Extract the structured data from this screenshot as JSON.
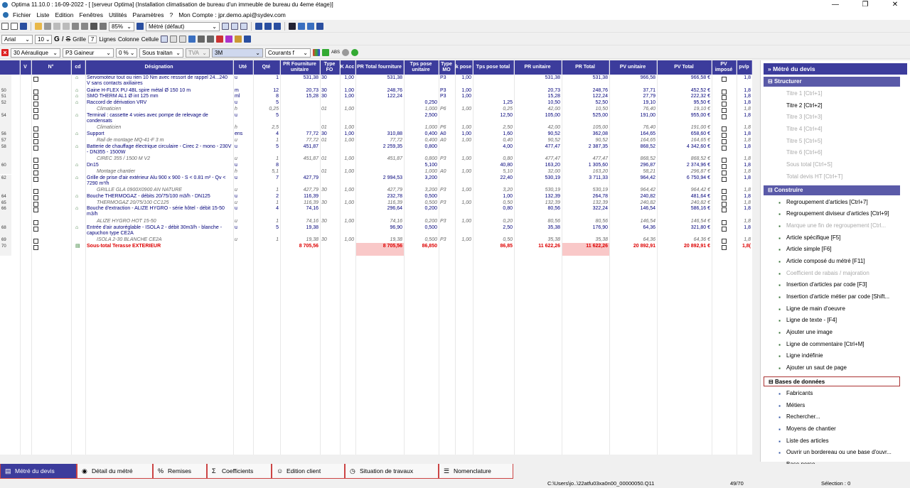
{
  "window": {
    "title": "Optima 11.10.0 : 16-09-2022 - [ [serveur Optima] (Installation climatisation de bureau d'un immeuble de bureau du 4eme étage)]",
    "buttons": [
      "—",
      "❐",
      "✕"
    ]
  },
  "menu": [
    "Fichier",
    "Liste",
    "Edition",
    "Fenêtres",
    "Utilités",
    "Paramètres",
    "?",
    "Mon Compte : jpr.demo.api@sydev.com"
  ],
  "toolbar1": {
    "zoom": "85%",
    "view": "Métré (défaut)"
  },
  "toolbar2": {
    "font": "Arial",
    "size": "10",
    "bold": "G",
    "italic": "I",
    "strike": "S",
    "grid_label": "Grille",
    "grid_value": "7",
    "lines_label": "Lignes",
    "column_label": "Colonne",
    "cell_label": "Cellule"
  },
  "toolbar3": {
    "lot": "30  Aéraulique",
    "family": "P3  Gaineur",
    "rate": "0 %",
    "subcontract": "Sous traitan",
    "tva": "TVA",
    "series": "3M",
    "currency": "Courants f",
    "abs": "ABS"
  },
  "columns": [
    "",
    "V",
    "N°",
    "cd",
    "Désignation",
    "Uté",
    "Qté",
    "PR Fourniture unitaire",
    "Type FO",
    "K Acc",
    "PR Total fourniture",
    "Tps pose unitaire",
    "Type MO",
    "k pose",
    "Tps pose total",
    "PR unitaire",
    "PR Total",
    "PV unitaire",
    "PV Total",
    "PV imposé",
    "pv/p"
  ],
  "rows": [
    {
      "ln": "",
      "des": "Servomoteur tout ou rien 10 Nm avec ressort de rappel 24...240 V sans contacts axiliaires",
      "u": "u",
      "q": "1",
      "pru": "531,38",
      "tfo": "30",
      "k": "1,00",
      "prt": "531,38",
      "tpu": "",
      "tmo": "P3",
      "kp": "1,00",
      "tpt": "",
      "pr": "531,38",
      "prtot": "531,38",
      "pvu": "966,58",
      "pvt": "966,58 €",
      "pp": "1,8",
      "h": 2
    },
    {
      "ln": "50",
      "des": "Gaine H-FLEX PU 4BL spire métal Ø 150 10 m",
      "u": "m",
      "q": "12",
      "pru": "20,73",
      "tfo": "30",
      "k": "1,00",
      "prt": "248,76",
      "tpu": "",
      "tmo": "P3",
      "kp": "1,00",
      "tpt": "",
      "pr": "20,73",
      "prtot": "248,76",
      "pvu": "37,71",
      "pvt": "452,52 €",
      "pp": "1,8",
      "h": 1
    },
    {
      "ln": "51",
      "des": "SMO THERM AL1 Ø int 125 mm",
      "u": "ml",
      "q": "8",
      "pru": "15,28",
      "tfo": "30",
      "k": "1,00",
      "prt": "122,24",
      "tpu": "",
      "tmo": "P3",
      "kp": "1,00",
      "tpt": "",
      "pr": "15,28",
      "prtot": "122,24",
      "pvu": "27,79",
      "pvt": "222,32 €",
      "pp": "1,8",
      "h": 1
    },
    {
      "ln": "52",
      "des": "Raccord de dérivation VRV",
      "u": "u",
      "q": "5",
      "pru": "",
      "tfo": "",
      "k": "",
      "prt": "",
      "tpu": "0,250",
      "tmo": "",
      "kp": "",
      "tpt": "1,25",
      "pr": "10,50",
      "prtot": "52,50",
      "pvu": "19,10",
      "pvt": "95,50 €",
      "pp": "1,8",
      "h": 1
    },
    {
      "ln": "",
      "des": "Climaticien",
      "u": "h",
      "q": "0,25",
      "pru": "",
      "tfo": "01",
      "k": "1,00",
      "prt": "",
      "tpu": "1,000",
      "tmo": "P6",
      "kp": "1,00",
      "tpt": "0,25",
      "pr": "42,00",
      "prtot": "10,50",
      "pvu": "76,40",
      "pvt": "19,10 €",
      "pp": "1,8",
      "h": 1,
      "sub": true
    },
    {
      "ln": "54",
      "des": "Terminal : cassette 4 voies avec pompe de relevage de condensats",
      "u": "u",
      "q": "5",
      "pru": "",
      "tfo": "",
      "k": "",
      "prt": "",
      "tpu": "2,500",
      "tmo": "",
      "kp": "",
      "tpt": "12,50",
      "pr": "105,00",
      "prtot": "525,00",
      "pvu": "191,00",
      "pvt": "955,00 €",
      "pp": "1,8",
      "h": 2
    },
    {
      "ln": "",
      "des": "Climaticien",
      "u": "h",
      "q": "2,5",
      "pru": "",
      "tfo": "01",
      "k": "1,00",
      "prt": "",
      "tpu": "1,000",
      "tmo": "P6",
      "kp": "1,00",
      "tpt": "2,50",
      "pr": "42,00",
      "prtot": "105,00",
      "pvu": "76,40",
      "pvt": "191,00 €",
      "pp": "1,8",
      "h": 1,
      "sub": true
    },
    {
      "ln": "56",
      "des": "Support",
      "u": "ens",
      "q": "4",
      "pru": "77,72",
      "tfo": "30",
      "k": "1,00",
      "prt": "310,88",
      "tpu": "0,400",
      "tmo": "A0",
      "kp": "1,00",
      "tpt": "1,60",
      "pr": "90,52",
      "prtot": "362,08",
      "pvu": "164,65",
      "pvt": "658,60 €",
      "pp": "1,8",
      "h": 1
    },
    {
      "ln": "57",
      "des": "Rail de montage MQ-41-F 3 m",
      "u": "u",
      "q": "1",
      "pru": "77,72",
      "tfo": "01",
      "k": "1,00",
      "prt": "77,72",
      "tpu": "0,400",
      "tmo": "A0",
      "kp": "1,00",
      "tpt": "0,40",
      "pr": "90,52",
      "prtot": "90,52",
      "pvu": "164,65",
      "pvt": "164,65 €",
      "pp": "1,8",
      "h": 1,
      "sub": true
    },
    {
      "ln": "58",
      "des": "Batterie de chauffage électrique circulaire - Cirec 2 - mono - 230V - DN355 - 1500W",
      "u": "u",
      "q": "5",
      "pru": "451,87",
      "tfo": "",
      "k": "",
      "prt": "2 259,35",
      "tpu": "0,800",
      "tmo": "",
      "kp": "",
      "tpt": "4,00",
      "pr": "477,47",
      "prtot": "2 387,35",
      "pvu": "868,52",
      "pvt": "4 342,60 €",
      "pp": "1,8",
      "h": 2
    },
    {
      "ln": "",
      "des": "CIREC 355 / 1500 M V2",
      "u": "u",
      "q": "1",
      "pru": "451,87",
      "tfo": "01",
      "k": "1,00",
      "prt": "451,87",
      "tpu": "0,800",
      "tmo": "P3",
      "kp": "1,00",
      "tpt": "0,80",
      "pr": "477,47",
      "prtot": "477,47",
      "pvu": "868,52",
      "pvt": "868,52 €",
      "pp": "1,8",
      "h": 1,
      "sub": true
    },
    {
      "ln": "60",
      "des": "Dn15",
      "u": "u",
      "q": "8",
      "pru": "",
      "tfo": "",
      "k": "",
      "prt": "",
      "tpu": "5,100",
      "tmo": "",
      "kp": "",
      "tpt": "40,80",
      "pr": "163,20",
      "prtot": "1 305,60",
      "pvu": "296,87",
      "pvt": "2 374,96 €",
      "pp": "1,8",
      "h": 1
    },
    {
      "ln": "",
      "des": "Montage chantier",
      "u": "h",
      "q": "5,1",
      "pru": "",
      "tfo": "01",
      "k": "1,00",
      "prt": "",
      "tpu": "1,000",
      "tmo": "A0",
      "kp": "1,00",
      "tpt": "5,10",
      "pr": "32,00",
      "prtot": "163,20",
      "pvu": "58,21",
      "pvt": "296,87 €",
      "pp": "1,8",
      "h": 1,
      "sub": true
    },
    {
      "ln": "62",
      "des": "Grille de prise d'air extérieur Alu 900 x 900 - S < 0.81 m² - Qv < 7290 m³/h",
      "u": "u",
      "q": "7",
      "pru": "427,79",
      "tfo": "",
      "k": "",
      "prt": "2 994,53",
      "tpu": "3,200",
      "tmo": "",
      "kp": "",
      "tpt": "22,40",
      "pr": "530,19",
      "prtot": "3 711,33",
      "pvu": "964,42",
      "pvt": "6 750,94 €",
      "pp": "1,8",
      "h": 2
    },
    {
      "ln": "",
      "des": "GRILLE GLA 0900X0900 AN NATURE",
      "u": "u",
      "q": "1",
      "pru": "427,79",
      "tfo": "30",
      "k": "1,00",
      "prt": "427,79",
      "tpu": "3,200",
      "tmo": "P3",
      "kp": "1,00",
      "tpt": "3,20",
      "pr": "530,19",
      "prtot": "530,19",
      "pvu": "964,42",
      "pvt": "964,42 €",
      "pp": "1,8",
      "h": 1,
      "sub": true
    },
    {
      "ln": "64",
      "des": "Bouche THERMOGAZ - débits 20/75/100 m3/h - DN125",
      "u": "u",
      "q": "2",
      "pru": "116,39",
      "tfo": "",
      "k": "",
      "prt": "232,78",
      "tpu": "0,500",
      "tmo": "",
      "kp": "",
      "tpt": "1,00",
      "pr": "132,39",
      "prtot": "264,78",
      "pvu": "240,82",
      "pvt": "481,64 €",
      "pp": "1,8",
      "h": 1
    },
    {
      "ln": "65",
      "des": "THERMOGAZ 20/75/100 CC125",
      "u": "u",
      "q": "1",
      "pru": "116,39",
      "tfo": "30",
      "k": "1,00",
      "prt": "116,39",
      "tpu": "0,500",
      "tmo": "P3",
      "kp": "1,00",
      "tpt": "0,50",
      "pr": "132,39",
      "prtot": "132,39",
      "pvu": "240,82",
      "pvt": "240,82 €",
      "pp": "1,8",
      "h": 1,
      "sub": true
    },
    {
      "ln": "66",
      "des": "Bouche d'extraction - ALIZE HYGRO - série hôtel - débit 15-50 m3/h",
      "u": "u",
      "q": "4",
      "pru": "74,16",
      "tfo": "",
      "k": "",
      "prt": "296,64",
      "tpu": "0,200",
      "tmo": "",
      "kp": "",
      "tpt": "0,80",
      "pr": "80,56",
      "prtot": "322,24",
      "pvu": "146,54",
      "pvt": "586,16 €",
      "pp": "1,8",
      "h": 2
    },
    {
      "ln": "",
      "des": "ALIZE HYGRO HOT 15-50",
      "u": "u",
      "q": "1",
      "pru": "74,16",
      "tfo": "30",
      "k": "1,00",
      "prt": "74,16",
      "tpu": "0,200",
      "tmo": "P3",
      "kp": "1,00",
      "tpt": "0,20",
      "pr": "80,56",
      "prtot": "80,56",
      "pvu": "146,54",
      "pvt": "146,54 €",
      "pp": "1,8",
      "h": 1,
      "sub": true
    },
    {
      "ln": "68",
      "des": "Entrée d'air autoréglable - ISOLA 2 - débit 30m3/h - blanche - capuchon type CE2A",
      "u": "u",
      "q": "5",
      "pru": "19,38",
      "tfo": "",
      "k": "",
      "prt": "96,90",
      "tpu": "0,500",
      "tmo": "",
      "kp": "",
      "tpt": "2,50",
      "pr": "35,38",
      "prtot": "176,90",
      "pvu": "64,36",
      "pvt": "321,80 €",
      "pp": "1,8",
      "h": 2
    },
    {
      "ln": "69",
      "des": "ISOLA 2-30 BLANCHE CE2A",
      "u": "u",
      "q": "1",
      "pru": "19,38",
      "tfo": "30",
      "k": "1,00",
      "prt": "19,38",
      "tpu": "0,500",
      "tmo": "P3",
      "kp": "1,00",
      "tpt": "0,50",
      "pr": "35,38",
      "prtot": "35,38",
      "pvu": "64,36",
      "pvt": "64,36 €",
      "pp": "1,8",
      "h": 1,
      "sub": true
    },
    {
      "ln": "70",
      "des": "Sous-total Terasse EXTERIEUR",
      "u": "",
      "q": "",
      "pru": "8 705,56",
      "tfo": "",
      "k": "",
      "prt": "8 705,56",
      "tpu": "86,850",
      "tmo": "",
      "kp": "",
      "tpt": "86,85",
      "pr": "11 622,26",
      "prtot": "11 622,26",
      "pvu": "20 892,91",
      "pvt": "20 892,91 €",
      "pp": "1,8(",
      "h": 2,
      "total": true
    }
  ],
  "panel": {
    "title": "Métré du devis",
    "sections": [
      {
        "label": "Structurer",
        "items": [
          {
            "t": "Titre 1 [Ctrl+1]",
            "d": true
          },
          {
            "t": "Titre 2 [Ctrl+2]",
            "d": false
          },
          {
            "t": "Titre 3 [Ctrl+3]",
            "d": true
          },
          {
            "t": "Titre 4 [Ctrl+4]",
            "d": true
          },
          {
            "t": "Titre 5 [Ctrl+5]",
            "d": true
          },
          {
            "t": "Titre 6 [Ctrl+6]",
            "d": true
          },
          {
            "t": "Sous total [Ctrl+S]",
            "d": true
          },
          {
            "t": "Total devis HT [Ctrl+T]",
            "d": true
          }
        ]
      },
      {
        "label": "Construire",
        "items": [
          {
            "t": "Regroupement d'articles  [Ctrl+7]",
            "d": false
          },
          {
            "t": "Regroupement diviseur d'articles [Ctrl+9]",
            "d": false
          },
          {
            "t": "Marque une fin de regroupement  [Ctrl...",
            "d": true
          },
          {
            "t": "Article spécifique [F5]",
            "d": false
          },
          {
            "t": "Article simple [F6]",
            "d": false
          },
          {
            "t": "Article composé du métré [F11]",
            "d": false
          },
          {
            "t": "Coefficient de rabais / majoration",
            "d": true
          },
          {
            "t": "Insertion d'articles par code [F3]",
            "d": false
          },
          {
            "t": "Insertion d'article métier par code [Shift...",
            "d": false
          },
          {
            "t": "Ligne de main d'oeuvre",
            "d": false
          },
          {
            "t": "Ligne de texte - [F4]",
            "d": false
          },
          {
            "t": "Ajouter une image",
            "d": false
          },
          {
            "t": "Ligne de commentaire [Ctrl+M]",
            "d": false
          },
          {
            "t": "Ligne indéfinie",
            "d": false
          },
          {
            "t": "Ajouter un saut de page",
            "d": false
          }
        ]
      },
      {
        "label": "Bases de données",
        "items": [
          {
            "t": "Fabricants",
            "d": false
          },
          {
            "t": "Métiers",
            "d": false
          },
          {
            "t": "Rechercher...",
            "d": false
          },
          {
            "t": "Moyens de chantier",
            "d": false
          },
          {
            "t": "Liste des articles",
            "d": false
          },
          {
            "t": "Ouvrir un bordereau ou une base d'ouvr...",
            "d": false
          },
          {
            "t": "Base perso",
            "d": false
          }
        ]
      }
    ]
  },
  "tabs": [
    "Métré du devis",
    "Détail du métré",
    "Remises",
    "Coefficients",
    "Edition client",
    "Situation de travaux",
    "Nomenclature"
  ],
  "status": {
    "path": "C:\\Users\\jo..\\22atfu03xa0n00_00000050.Q11",
    "count": "49/70",
    "selection": "Sélection : 0"
  }
}
